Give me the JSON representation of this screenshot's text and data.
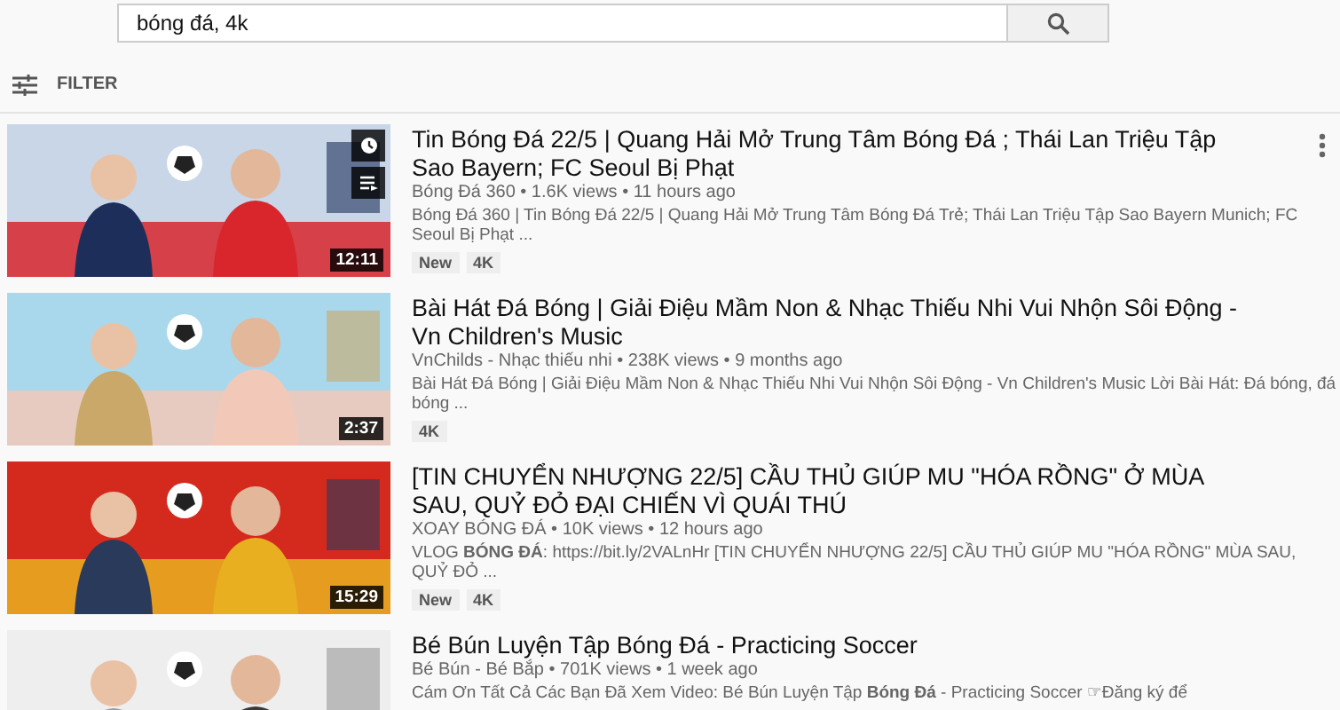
{
  "search": {
    "value": "bóng đá, 4k"
  },
  "filter": {
    "label": "FILTER"
  },
  "videos": [
    {
      "title": "Tin Bóng Đá 22/5 | Quang Hải Mở Trung Tâm Bóng Đá ; Thái Lan Triệu Tập Sao Bayern; FC Seoul Bị Phạt",
      "meta": "Bóng Đá 360 • 1.6K views • 11 hours ago",
      "description": "Bóng Đá 360 | Tin Bóng Đá 22/5 | Quang Hải Mở Trung Tâm Bóng Đá Trẻ; Thái Lan Triệu Tập Sao Bayern Munich; FC Seoul Bị Phạt ...",
      "badges": [
        "New",
        "4K"
      ],
      "duration": "12:11",
      "hovered": true
    },
    {
      "title": "Bài Hát Đá Bóng | Giải Điệu Mầm Non & Nhạc Thiếu Nhi Vui Nhộn Sôi Động - Vn Children's Music",
      "meta": "VnChilds - Nhạc thiếu nhi • 238K views • 9 months ago",
      "description": "Bài Hát Đá Bóng | Giải Điệu Mầm Non & Nhạc Thiếu Nhi Vui Nhộn Sôi Động - Vn Children's Music Lời Bài Hát: Đá bóng, đá bóng ...",
      "badges": [
        "4K"
      ],
      "duration": "2:37",
      "hovered": false
    },
    {
      "title": "[TIN CHUYỂN NHƯỢNG 22/5] CẦU THỦ GIÚP MU \"HÓA RỒNG\" Ở MÙA SAU, QUỶ ĐỎ ĐẠI CHIẾN VÌ QUÁI THÚ",
      "meta": "XOAY BÓNG ĐÁ • 10K views • 12 hours ago",
      "description": "VLOG **BÓNG ĐÁ**: https://bit.ly/2VALnHr [TIN CHUYỂN NHƯỢNG 22/5] CẦU THỦ GIÚP MU \"HÓA RỒNG\" MÙA SAU, QUỶ ĐỎ ...",
      "badges": [
        "New",
        "4K"
      ],
      "duration": "15:29",
      "hovered": false
    },
    {
      "title": "Bé Bún Luyện Tập Bóng Đá - Practicing Soccer",
      "meta": "Bé Bún - Bé Bắp • 701K views • 1 week ago",
      "description": "Cám Ơn Tất Cả Các Bạn Đã Xem Video: Bé Bún Luyện Tập **Bóng Đá** - Practicing Soccer ☞Đăng ký để",
      "hovered": false
    }
  ]
}
